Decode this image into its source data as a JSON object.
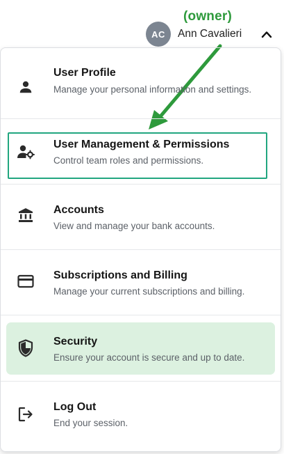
{
  "annotation": {
    "owner_label": "(owner)"
  },
  "header": {
    "avatar_initials": "AC",
    "user_name": "Ann Cavalieri",
    "chevron_icon": "chevron-up-icon"
  },
  "menu": {
    "items": [
      {
        "icon": "person-icon",
        "title": "User Profile",
        "description": "Manage your personal information and settings."
      },
      {
        "icon": "user-gear-icon",
        "title": "User Management & Permissions",
        "description": "Control team roles and permissions."
      },
      {
        "icon": "bank-icon",
        "title": "Accounts",
        "description": "View and manage your bank accounts."
      },
      {
        "icon": "credit-card-icon",
        "title": "Subscriptions and Billing",
        "description": "Manage your current subscriptions and billing."
      },
      {
        "icon": "shield-icon",
        "title": "Security",
        "description": "Ensure your account is secure and up to date."
      },
      {
        "icon": "logout-icon",
        "title": "Log Out",
        "description": "End your session."
      }
    ]
  },
  "colors": {
    "annotation_green": "#2e9a3c",
    "highlight_border": "#21a67f",
    "security_selected_bg": "#dcf1e0",
    "avatar_bg": "#7c8591"
  }
}
